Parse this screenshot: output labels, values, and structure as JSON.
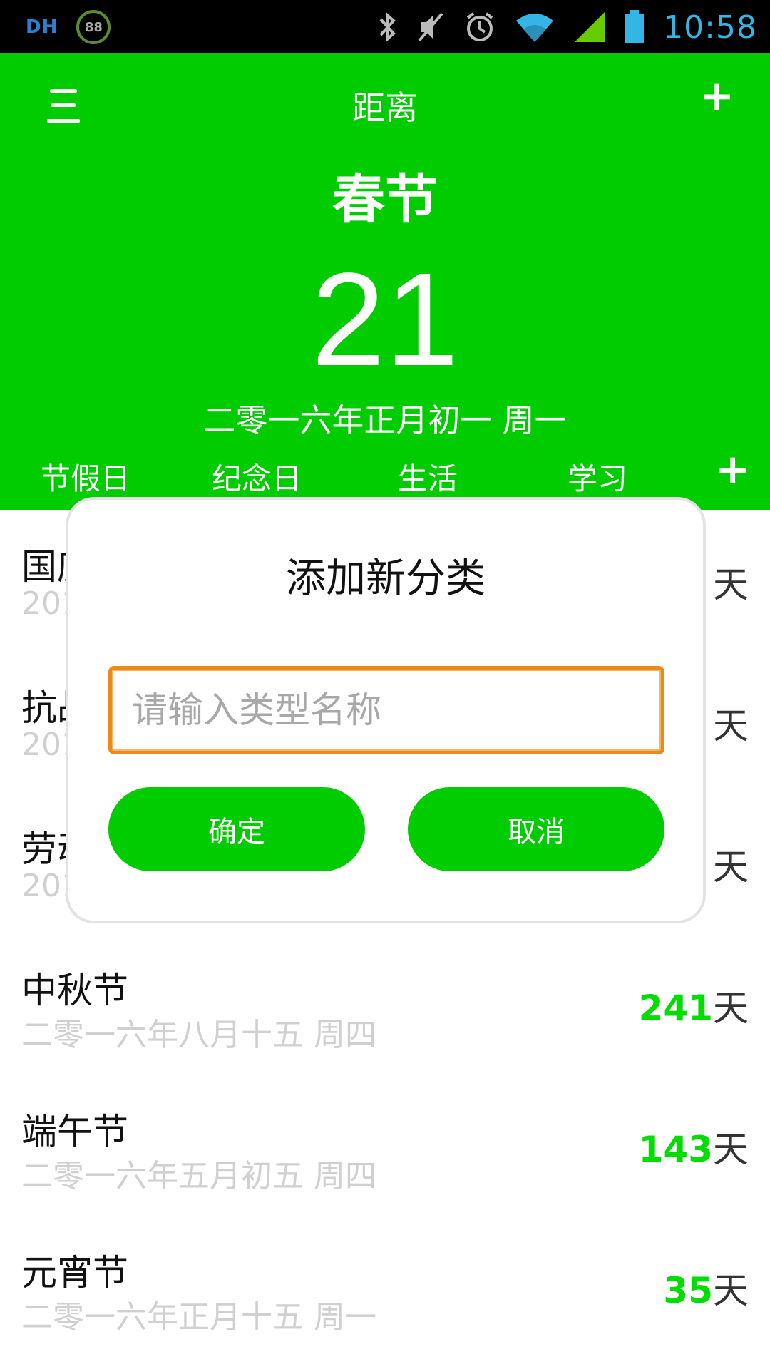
{
  "status_bar": {
    "time": "10:58",
    "left_text": "DH",
    "badge": "88",
    "icons": [
      "bluetooth-icon",
      "mute-icon",
      "alarm-icon",
      "wifi-icon",
      "signal-icon",
      "battery-icon"
    ]
  },
  "header": {
    "title": "距离",
    "event_name": "春节",
    "days": "21",
    "date": "二零一六年正月初一 周一",
    "tabs": [
      "节假日",
      "纪念日",
      "生活",
      "学习"
    ],
    "accent_color": "#00cc00"
  },
  "list": {
    "items": [
      {
        "title": "国庆",
        "date": "201",
        "days_num": "",
        "days_unit": "天"
      },
      {
        "title": "抗战",
        "date": "201",
        "days_num": "",
        "days_unit": "天"
      },
      {
        "title": "劳动",
        "date": "201",
        "days_num": "",
        "days_unit": "天"
      },
      {
        "title": "中秋节",
        "date": "二零一六年八月十五 周四",
        "days_num": "241",
        "days_unit": "天"
      },
      {
        "title": "端午节",
        "date": "二零一六年五月初五 周四",
        "days_num": "143",
        "days_unit": "天"
      },
      {
        "title": "元宵节",
        "date": "二零一六年正月十五 周一",
        "days_num": "35",
        "days_unit": "天"
      }
    ]
  },
  "dialog": {
    "title": "添加新分类",
    "input_placeholder": "请输入类型名称",
    "input_value": "",
    "ok_label": "确定",
    "cancel_label": "取消",
    "input_border_color": "#f08a16"
  }
}
